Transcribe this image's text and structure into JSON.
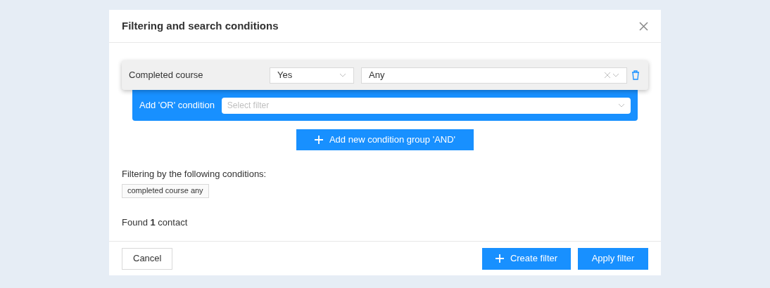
{
  "dialog": {
    "title": "Filtering and search conditions",
    "condition": {
      "label": "Completed course",
      "operator": "Yes",
      "value": "Any"
    },
    "or_condition": {
      "label": "Add 'OR' condition",
      "placeholder": "Select filter"
    },
    "add_group_button": "Add new condition group 'AND'",
    "summary_label": "Filtering by the following conditions:",
    "tags": [
      "completed course any"
    ],
    "result": "Found **1** contact",
    "buttons": {
      "cancel": "Cancel",
      "create": "Create filter",
      "apply": "Apply filter"
    }
  }
}
